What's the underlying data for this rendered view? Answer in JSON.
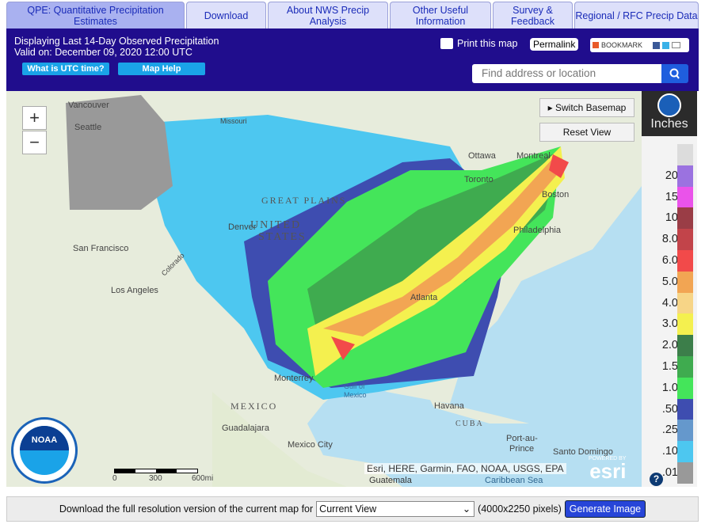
{
  "tabs": [
    "QPE: Quantitative Precipitation Estimates",
    "Download",
    "About NWS Precip Analysis",
    "Other Useful Information",
    "Survey & Feedback",
    "Regional / RFC Precip Data"
  ],
  "header": {
    "line1": "Displaying Last 14-Day Observed Precipitation",
    "line2": "Valid on: December 09, 2020 12:00 UTC",
    "utc_button": "What is UTC time?",
    "help_button": "Map Help",
    "print": "Print this map",
    "permalink": "Permalink",
    "bookmark": "BOOKMARK",
    "search_placeholder": "Find address or location"
  },
  "map": {
    "zoom_in": "+",
    "zoom_out": "−",
    "switch_basemap": "Switch Basemap",
    "reset_view": "Reset View",
    "labels": [
      "Vancouver",
      "Seattle",
      "Missouri",
      "Ottawa",
      "Montreal",
      "Toronto",
      "Boston",
      "Philadelphia",
      "GREAT PLAINS",
      "UNITED",
      "STATES",
      "Denver",
      "San Francisco",
      "Los Angeles",
      "Colorado",
      "Atlanta",
      "Monterrey",
      "Gulf of",
      "Mexico",
      "MEXICO",
      "Havana",
      "CUBA",
      "Guadalajara",
      "Mexico City",
      "Port-au-",
      "Prince",
      "Santo Domingo",
      "Guatemala",
      "Caribbean Sea"
    ],
    "scale": [
      "0",
      "300",
      "600mi"
    ],
    "attribution": "Esri, HERE, Garmin, FAO, NOAA, USGS, EPA",
    "esri_powered": "POWERED BY",
    "esri": "esri",
    "noaa": "NOAA"
  },
  "legend": {
    "unit": "Inches",
    "help": "?",
    "items": [
      {
        "label": "",
        "color": "#dcdcdc"
      },
      {
        "label": "20",
        "color": "#9b72e0"
      },
      {
        "label": "15",
        "color": "#ea53ea"
      },
      {
        "label": "10",
        "color": "#9a3d46"
      },
      {
        "label": "8.0",
        "color": "#c2444a"
      },
      {
        "label": "6.0",
        "color": "#f24a4a"
      },
      {
        "label": "5.0",
        "color": "#f2a553"
      },
      {
        "label": "4.0",
        "color": "#f7d587"
      },
      {
        "label": "3.0",
        "color": "#f4f04f"
      },
      {
        "label": "2.0",
        "color": "#3c7e4a"
      },
      {
        "label": "1.5",
        "color": "#3fab4f"
      },
      {
        "label": "1.0",
        "color": "#44e55a"
      },
      {
        "label": ".50",
        "color": "#3e4db0"
      },
      {
        "label": ".25",
        "color": "#6598cc"
      },
      {
        "label": ".10",
        "color": "#4dc7f0"
      },
      {
        "label": ".01",
        "color": "#999999"
      }
    ]
  },
  "download": {
    "text": "Download the full resolution version of the current map for",
    "selected": "Current View",
    "pixels": "(4000x2250 pixels)",
    "button": "Generate Image"
  }
}
